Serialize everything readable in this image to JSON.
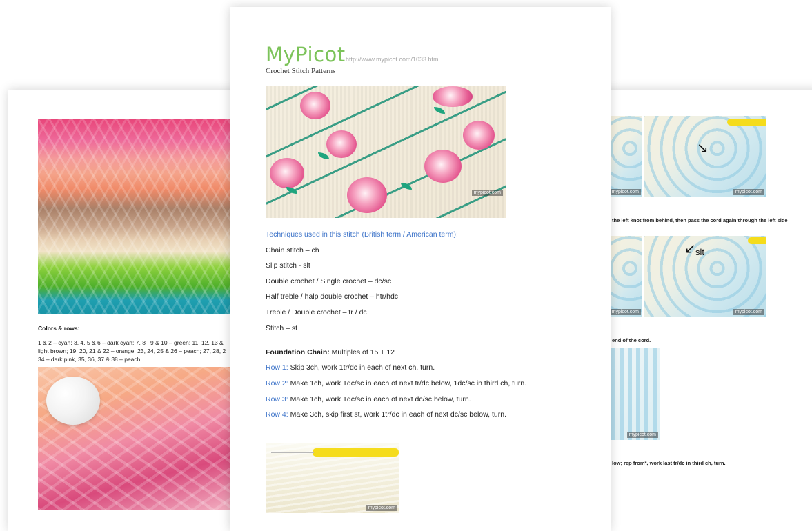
{
  "left_page": {
    "colors_heading": "Colors & rows:",
    "colors_rows": "1 & 2 – cyan; 3, 4, 5 & 6 – dark cyan; 7, 8 , 9 & 10 – green; 11, 12, 13 &\nlight brown; 19, 20, 21 & 22 – orange; 23, 24, 25 & 26 – peach; 27, 28, 2\n34 – dark pink, 35, 36, 37 & 38 – peach."
  },
  "center_page": {
    "brand": "MyPicot",
    "url": "http://www.mypicot.com/1033.html",
    "subtitle": "Crochet Stitch Patterns",
    "photo_watermark": "mypicot.com",
    "techniques_heading": "Techniques used in this stitch (British term / American term):",
    "techniques": [
      "Chain stitch – ch",
      "Slip stitch - slt",
      "Double crochet / Single crochet – dc/sc",
      "Half treble / halp double crochet – htr/hdc",
      "Treble / Double crochet – tr / dc",
      "Stitch – st"
    ],
    "foundation_label": "Foundation Chain:",
    "foundation_value": " Multiples of 15 + 12",
    "rows": [
      {
        "label": "Row 1:",
        "text": " Skip 3ch, work 1tr/dc in each of next ch, turn."
      },
      {
        "label": "Row 2:",
        "text": " Make 1ch, work 1dc/sc in each of next tr/dc below, 1dc/sc in third ch, turn."
      },
      {
        "label": "Row 3:",
        "text": " Make 1ch, work 1dc/sc in each of next dc/sc below, turn."
      },
      {
        "label": "Row 4:",
        "text": " Make 3ch, skip first st, work 1tr/dc in each of next dc/sc below, turn."
      }
    ],
    "photo2_watermark": "mypicot.com"
  },
  "right_page": {
    "watermark": "mypicot.com",
    "caption1": "the left knot from behind, then pass the cord again through the left side",
    "slt_label": "slt",
    "caption2": "end of the cord.",
    "caption3": "low; rep from*, work last tr/dc in third ch, turn."
  },
  "colors": {
    "brand_green": "#7cc35a",
    "link_blue": "#3b72c8",
    "url_gray": "#a8a8a8"
  }
}
